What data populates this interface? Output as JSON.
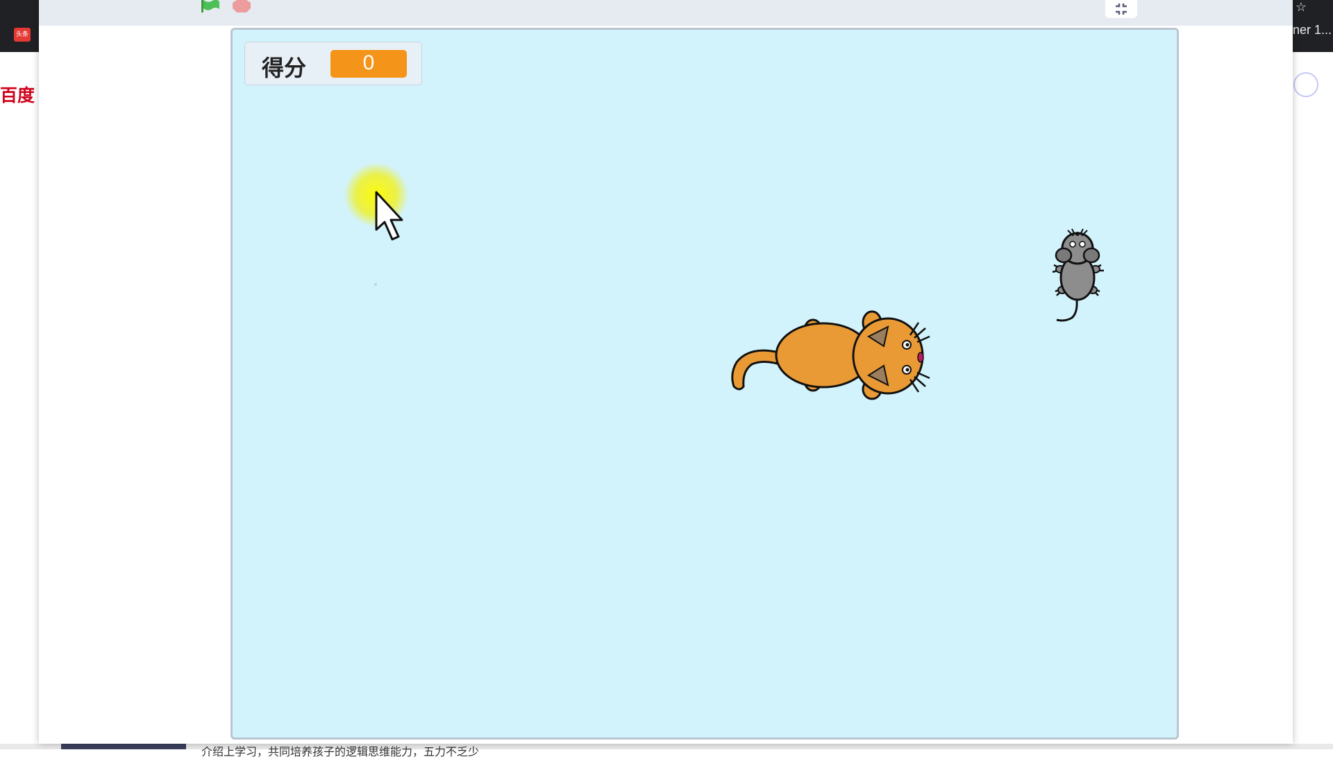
{
  "browser": {
    "tab_right_text": "ner 1...",
    "bookmark_icon_text": "头条",
    "baidu_logo_text": "百度",
    "bottom_text": "介绍上学习，共同培养孩子的逻辑思维能力，五力不乏少"
  },
  "player": {
    "green_flag_icon": "green-flag-icon",
    "stop_icon": "stop-sign-icon",
    "exit_fullscreen_icon": "exit-fullscreen-icon"
  },
  "stage": {
    "background_color": "#d2f3fb",
    "score_monitor": {
      "label": "得分",
      "value": "0"
    },
    "sprites": [
      "cat",
      "mouse"
    ],
    "cursor": "arrow-pointer-with-yellow-highlight"
  },
  "colors": {
    "score_value_bg": "#f49418",
    "cat_body": "#e99a35",
    "mouse_body": "#8d8d8d"
  }
}
